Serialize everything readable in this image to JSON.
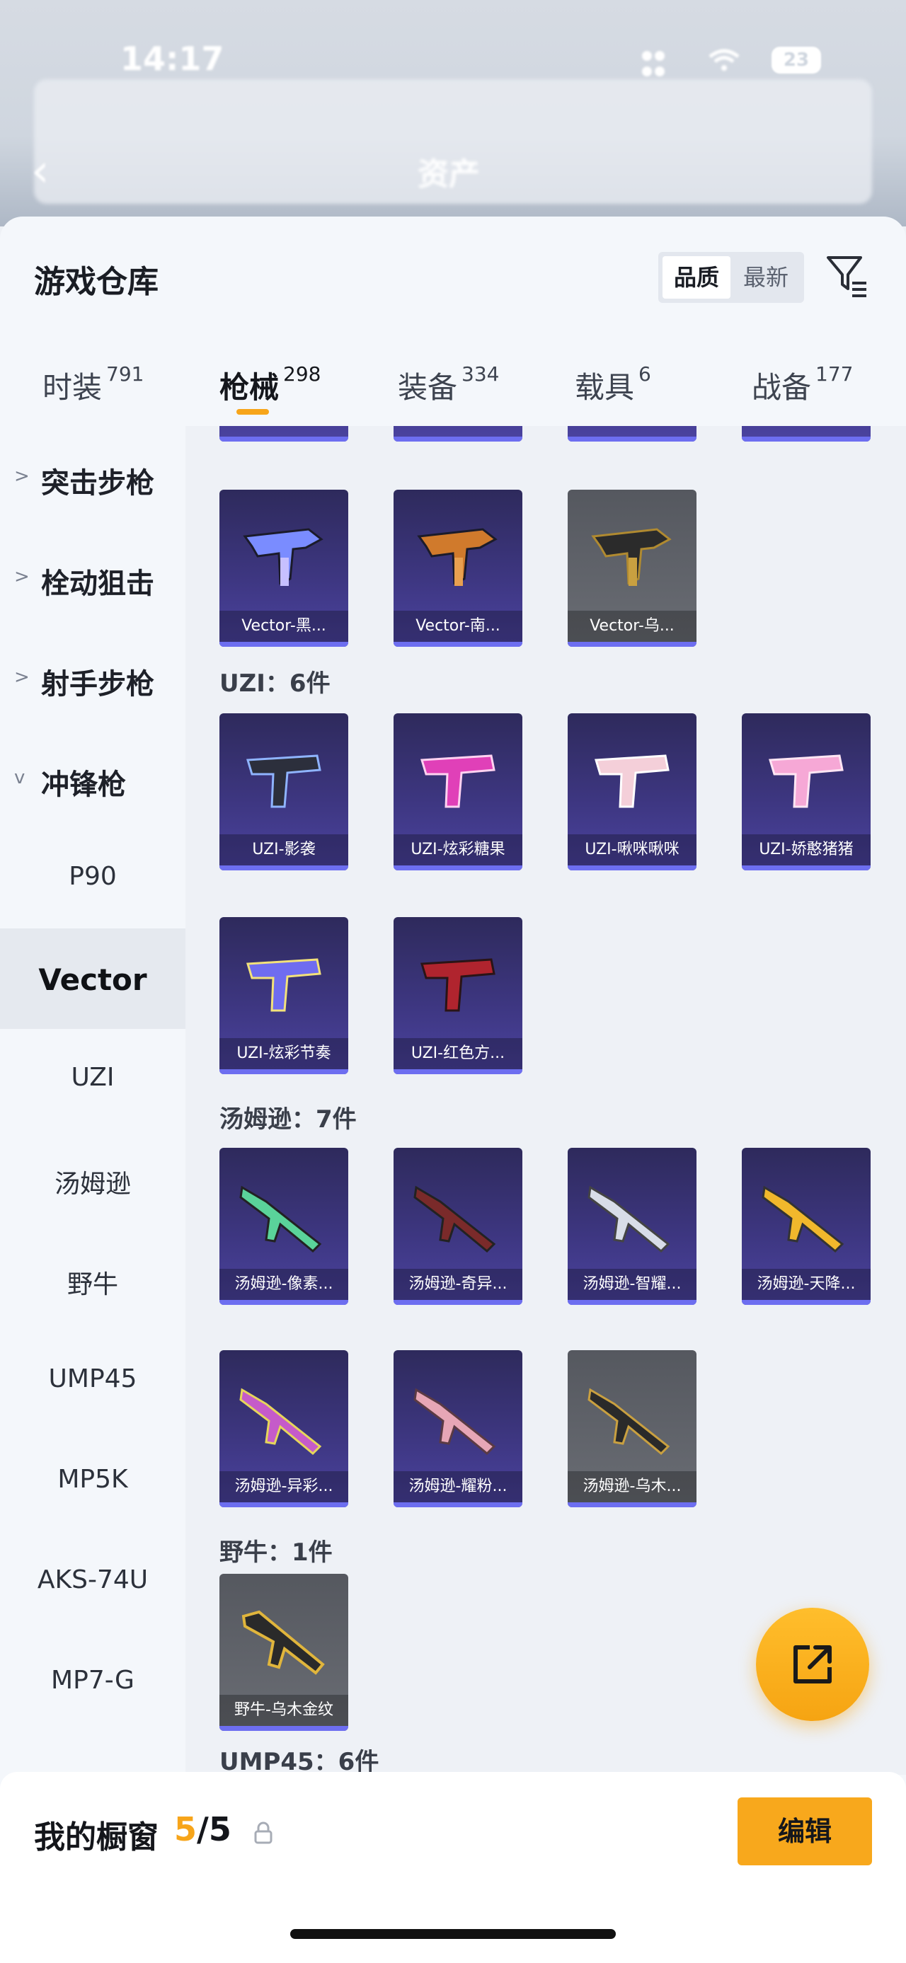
{
  "status_bar": {
    "time": "14:17",
    "battery": "23"
  },
  "nav": {
    "title": "资产"
  },
  "sheet": {
    "title": "游戏仓库",
    "sort": {
      "active": "品质",
      "inactive": "最新"
    }
  },
  "tabs": [
    {
      "label": "时装",
      "count": "791"
    },
    {
      "label": "枪械",
      "count": "298"
    },
    {
      "label": "装备",
      "count": "334"
    },
    {
      "label": "载具",
      "count": "6"
    },
    {
      "label": "战备",
      "count": "177"
    }
  ],
  "sidebar": {
    "groups": [
      "突击步枪",
      "栓动狙击",
      "射手步枪",
      "冲锋枪"
    ],
    "subs": [
      "P90",
      "Vector",
      "UZI",
      "汤姆逊",
      "野牛",
      "UMP45",
      "MP5K",
      "AKS-74U",
      "MP7-G"
    ]
  },
  "sections": {
    "vector_cards": [
      "Vector-黑...",
      "Vector-南...",
      "Vector-乌..."
    ],
    "uzi_label": "UZI：6件",
    "uzi_cards": [
      "UZI-影袭",
      "UZI-炫彩糖果",
      "UZI-啾咪啾咪",
      "UZI-娇憨猪猪",
      "UZI-炫彩节奏",
      "UZI-红色方..."
    ],
    "tommy_label": "汤姆逊：7件",
    "tommy_cards": [
      "汤姆逊-像素...",
      "汤姆逊-奇异...",
      "汤姆逊-智耀...",
      "汤姆逊-天降...",
      "汤姆逊-异彩...",
      "汤姆逊-耀粉...",
      "汤姆逊-乌木..."
    ],
    "bison_label": "野牛：1件",
    "bison_cards": [
      "野牛-乌木金纹"
    ],
    "ump_label": "UMP45：6件"
  },
  "bottom": {
    "title": "我的橱窗",
    "current": "5",
    "total": "/5",
    "edit": "编辑"
  },
  "colors": {
    "accent": "#f7a51a",
    "card_purple": "#3d3680",
    "card_gray": "#5e6168",
    "rarity_bar": "#6d6ef0"
  },
  "icons": [
    "back-arrow-icon",
    "filter-icon",
    "chevron-right-icon",
    "chevron-down-icon",
    "share-icon",
    "lock-icon"
  ]
}
